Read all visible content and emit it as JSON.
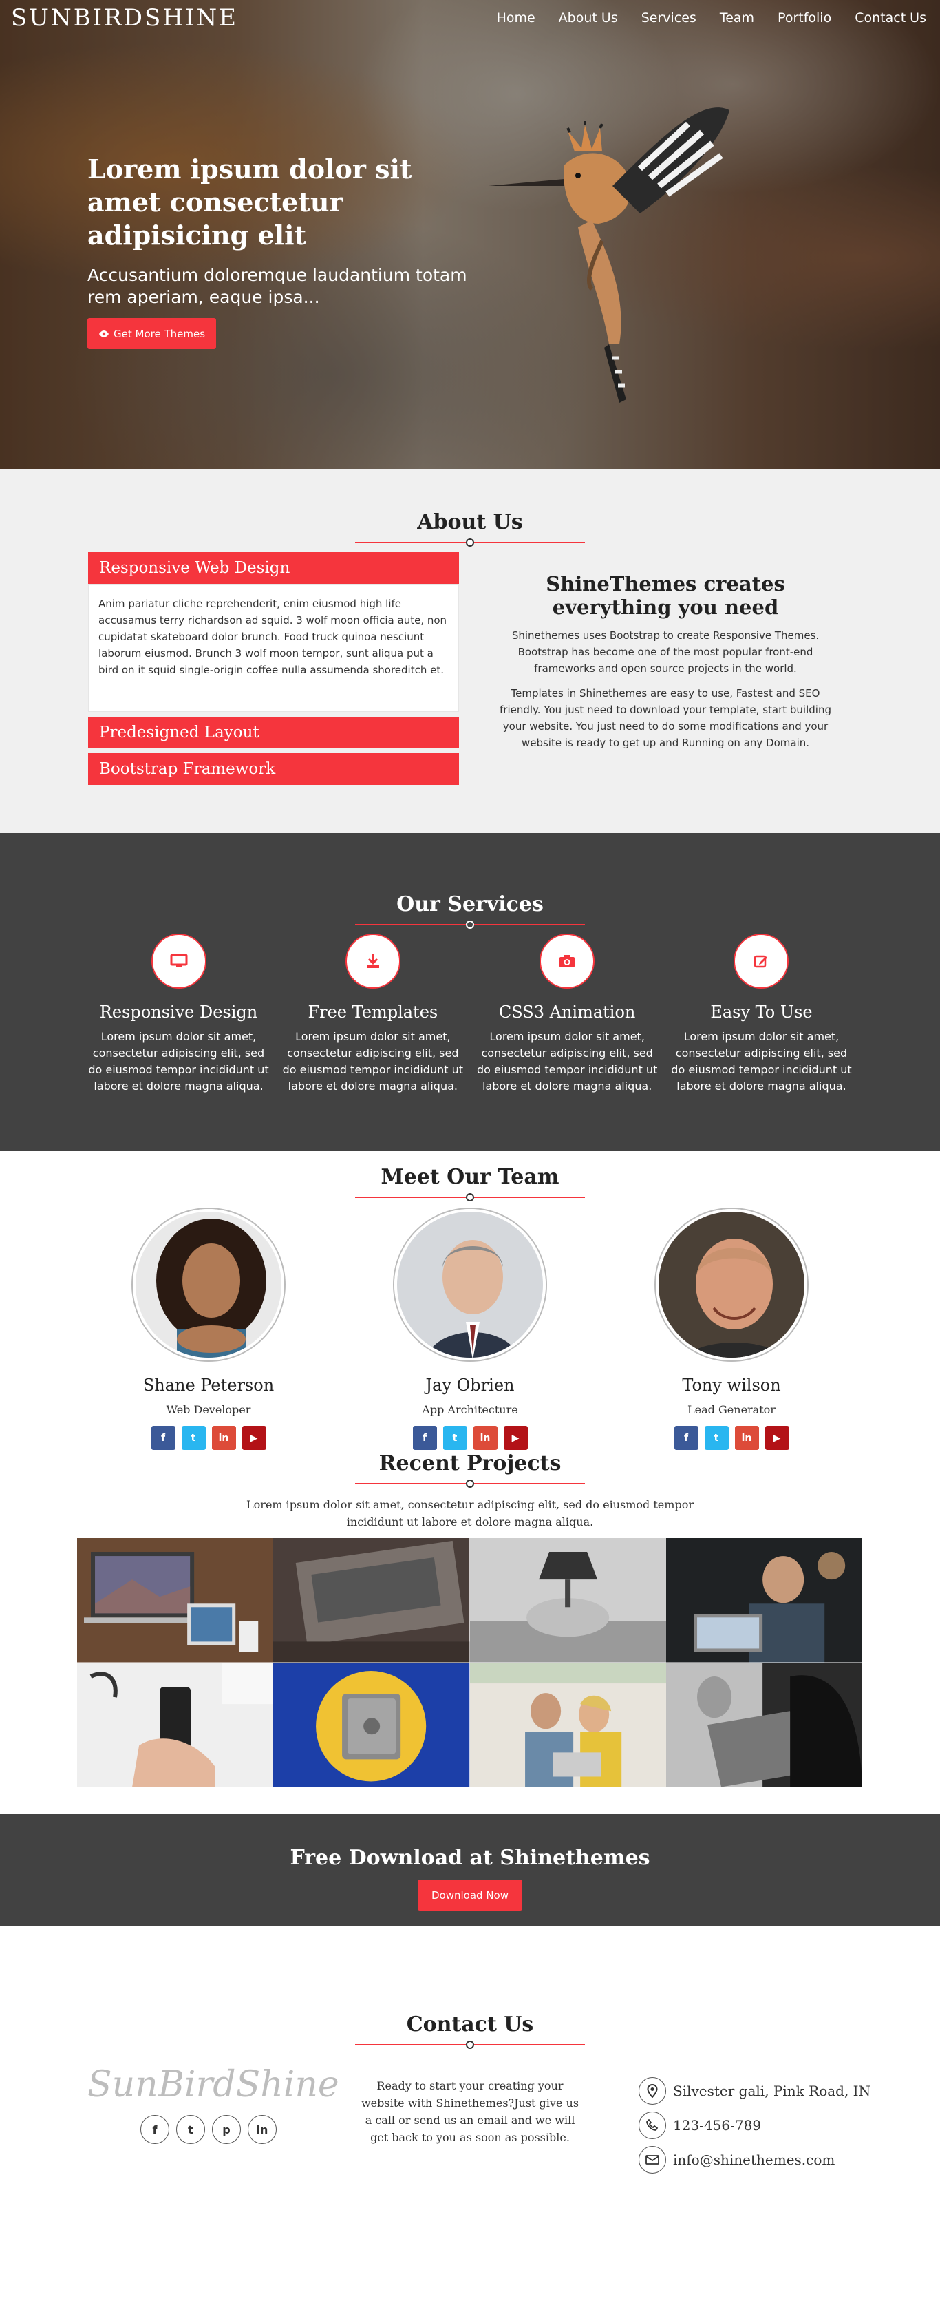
{
  "nav": {
    "brand": "SUNBIRDSHINE",
    "items": [
      "Home",
      "About Us",
      "Services",
      "Team",
      "Portfolio",
      "Contact Us"
    ]
  },
  "hero": {
    "title": "Lorem ipsum dolor sit amet consectetur adipisicing elit",
    "subtitle": "Accusantium doloremque laudantium totam rem aperiam, eaque ipsa...",
    "button": "Get More Themes",
    "button_icon": "eye-icon"
  },
  "about": {
    "title": "About Us",
    "accordion": [
      {
        "label": "Responsive Web Design",
        "body": "Anim pariatur cliche reprehenderit, enim eiusmod high life accusamus terry richardson ad squid. 3 wolf moon officia aute, non cupidatat skateboard dolor brunch. Food truck quinoa nesciunt laborum eiusmod. Brunch 3 wolf moon tempor, sunt aliqua put a bird on it squid single-origin coffee nulla assumenda shoreditch et."
      },
      {
        "label": "Predesigned Layout"
      },
      {
        "label": "Bootstrap Framework"
      }
    ],
    "right_title": "ShineThemes creates everything you need",
    "para1": "Shinethemes uses Bootstrap to create Responsive Themes. Bootstrap has become one of the most popular front-end frameworks and open source projects in the world.",
    "para2": "Templates in Shinethemes are easy to use, Fastest and SEO friendly. You just need to download your template, start building your website. You just need to do some modifications and your website is ready to get up and Running on any Domain."
  },
  "services": {
    "title": "Our Services",
    "items": [
      {
        "name": "Responsive Design",
        "icon": "monitor-icon",
        "text": "Lorem ipsum dolor sit amet, consectetur adipiscing elit, sed do eiusmod tempor incididunt ut labore et dolore magna aliqua."
      },
      {
        "name": "Free Templates",
        "icon": "download-icon",
        "text": "Lorem ipsum dolor sit amet, consectetur adipiscing elit, sed do eiusmod tempor incididunt ut labore et dolore magna aliqua."
      },
      {
        "name": "CSS3 Animation",
        "icon": "camera-icon",
        "text": "Lorem ipsum dolor sit amet, consectetur adipiscing elit, sed do eiusmod tempor incididunt ut labore et dolore magna aliqua."
      },
      {
        "name": "Easy To Use",
        "icon": "edit-icon",
        "text": "Lorem ipsum dolor sit amet, consectetur adipiscing elit, sed do eiusmod tempor incididunt ut labore et dolore magna aliqua."
      }
    ]
  },
  "team": {
    "title": "Meet Our Team",
    "members": [
      {
        "name": "Shane Peterson",
        "role": "Web Developer"
      },
      {
        "name": "Jay Obrien",
        "role": "App Architecture"
      },
      {
        "name": "Tony wilson",
        "role": "Lead Generator"
      }
    ],
    "social": [
      {
        "label": "f",
        "icon": "facebook-icon",
        "color": "#3b5998"
      },
      {
        "label": "t",
        "icon": "twitter-icon",
        "color": "#29b6f0"
      },
      {
        "label": "in",
        "icon": "linkedin-icon",
        "color": "#dd4b39"
      },
      {
        "label": "▶",
        "icon": "youtube-icon",
        "color": "#b31217"
      }
    ]
  },
  "projects": {
    "title": "Recent Projects",
    "lead": "Lorem ipsum dolor sit amet, consectetur adipiscing elit, sed do eiusmod tempor incididunt ut labore et dolore magna aliqua."
  },
  "cta": {
    "title": "Free Download at Shinethemes",
    "button": "Download Now"
  },
  "contact": {
    "title": "Contact Us",
    "logo": "SunBirdShine",
    "social": [
      "f",
      "t",
      "p",
      "in"
    ],
    "message": "Ready to start your creating your website with Shinethemes?Just give us a call or send us an email and we will get back to you as soon as possible.",
    "address": "Silvester gali, Pink Road, IN",
    "phone": "123-456-789",
    "email": "info@shinethemes.com"
  },
  "colors": {
    "accent": "#f5353d",
    "dark": "#424242",
    "light": "#f0f0f0"
  }
}
